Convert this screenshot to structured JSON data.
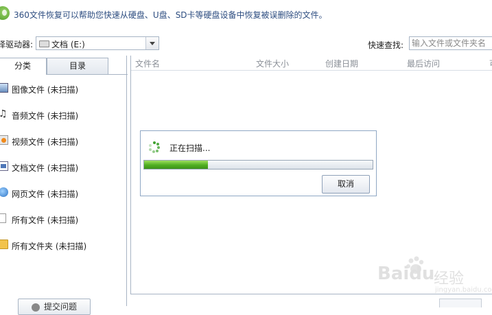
{
  "banner": {
    "message": "360文件恢复可以帮助您快速从硬盘、U盘、SD卡等硬盘设备中恢复被误删除的文件。"
  },
  "toolbar": {
    "drive_label": "择驱动器:",
    "drive_value": "文档 (E:)",
    "quick_label": "快速查找:",
    "quick_placeholder": "输入文件或文件夹名"
  },
  "tabs": [
    {
      "label": "分类"
    },
    {
      "label": "目录"
    }
  ],
  "categories": [
    {
      "label": "图像文件 (未扫描)",
      "icon": "image-file-icon"
    },
    {
      "label": "音频文件 (未扫描)",
      "icon": "music-note-icon"
    },
    {
      "label": "视频文件 (未扫描)",
      "icon": "video-file-icon"
    },
    {
      "label": "文档文件 (未扫描)",
      "icon": "document-file-icon"
    },
    {
      "label": "网页文件 (未扫描)",
      "icon": "web-file-icon"
    },
    {
      "label": "所有文件 (未扫描)",
      "icon": "blank-file-icon"
    },
    {
      "label": "所有文件夹 (未扫描)",
      "icon": "folder-icon"
    }
  ],
  "feedback": {
    "label": "提交问题"
  },
  "columns": [
    "文件名",
    "文件大小",
    "创建日期",
    "最后访问",
    "可"
  ],
  "dialog": {
    "status": "正在扫描...",
    "progress_fraction": 0.28,
    "cancel_label": "取消"
  },
  "watermark": {
    "brand": "Bai",
    "brand2": "du",
    "site": "经验",
    "url": "jingyan.baidu.com"
  },
  "colors": {
    "progress_green": "#4fae21",
    "border": "#a7b4c4",
    "link_blue": "#2d4d80"
  }
}
